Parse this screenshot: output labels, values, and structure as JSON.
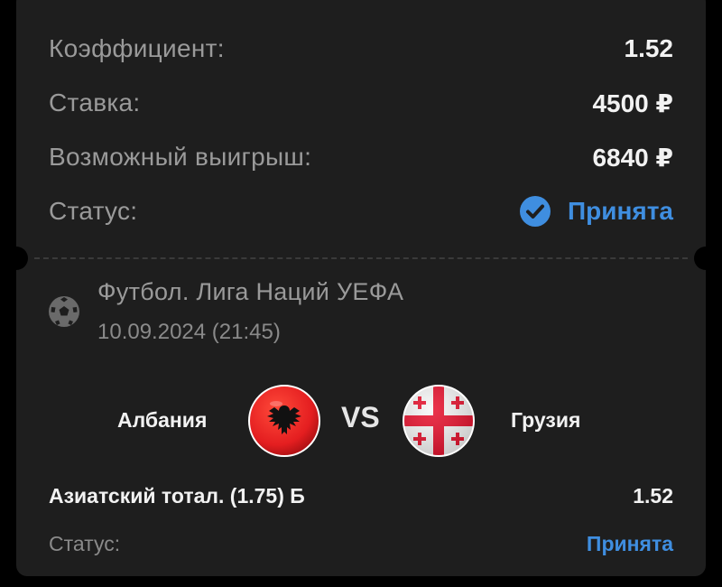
{
  "summary": {
    "odds_label": "Коэффициент:",
    "odds_value": "1.52",
    "stake_label": "Ставка:",
    "stake_value": "4500 ₽",
    "payout_label": "Возможный выигрыш:",
    "payout_value": "6840 ₽",
    "status_label": "Статус:",
    "status_value": "Принята",
    "status_icon": "check-circle-icon"
  },
  "event": {
    "sport_icon": "soccer-ball-icon",
    "title": "Футбол. Лига Наций УЕФА",
    "date": "10.09.2024 (21:45)",
    "home_team": "Албания",
    "home_flag": "albania-flag-icon",
    "vs": "VS",
    "away_team": "Грузия",
    "away_flag": "georgia-flag-icon"
  },
  "selection": {
    "market": "Азиатский тотал. (1.75) Б",
    "odds": "1.52",
    "status_label": "Статус:",
    "status_value": "Принята"
  },
  "colors": {
    "background": "#000000",
    "card": "#1e1e1e",
    "accent": "#3f8ee0",
    "muted_text": "#9a9a9a",
    "primary_text": "#f2f2f2",
    "albania_red": "#e41e20",
    "georgia_red": "#e8112d"
  }
}
